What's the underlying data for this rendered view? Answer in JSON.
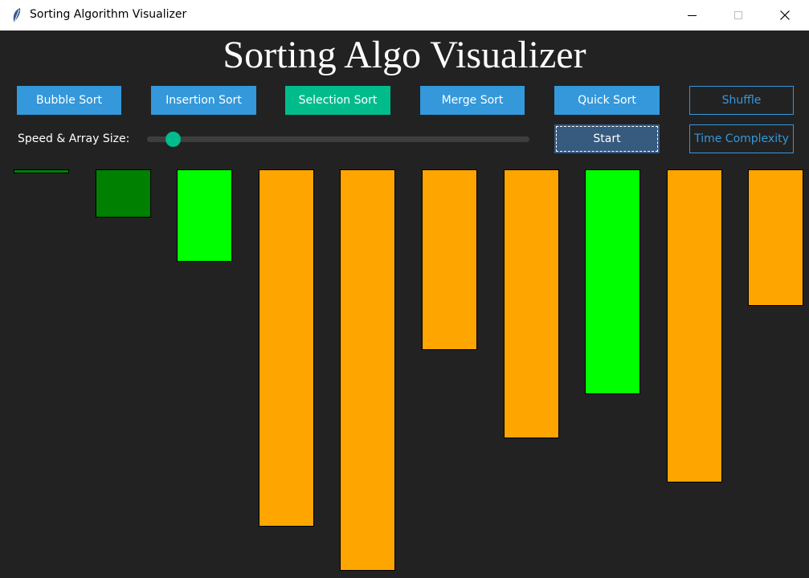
{
  "window": {
    "title": "Sorting Algorithm Visualizer",
    "controls": [
      "minimize-icon",
      "maximize-icon",
      "close-icon"
    ]
  },
  "heading": "Sorting Algo Visualizer",
  "buttons": {
    "bubble": "Bubble Sort",
    "insertion": "Insertion Sort",
    "selection": "Selection Sort",
    "merge": "Merge Sort",
    "quick": "Quick Sort",
    "shuffle": "Shuffle",
    "start": "Start",
    "time_complexity": "Time Complexity"
  },
  "slider": {
    "label": "Speed & Array Size:",
    "value_fraction": 0.05
  },
  "colors": {
    "background": "#222222",
    "button_blue": "#3498db",
    "button_selected": "#00bc8c",
    "start_button": "#375a7f",
    "bar_default": "orange",
    "bar_sorted": "green",
    "bar_active": "lime"
  },
  "array": {
    "values": [
      1,
      12,
      23,
      89,
      100,
      45,
      67,
      56,
      78,
      34
    ],
    "states": [
      "sorted",
      "sorted",
      "active",
      "default",
      "default",
      "default",
      "default",
      "active",
      "default",
      "default"
    ]
  }
}
